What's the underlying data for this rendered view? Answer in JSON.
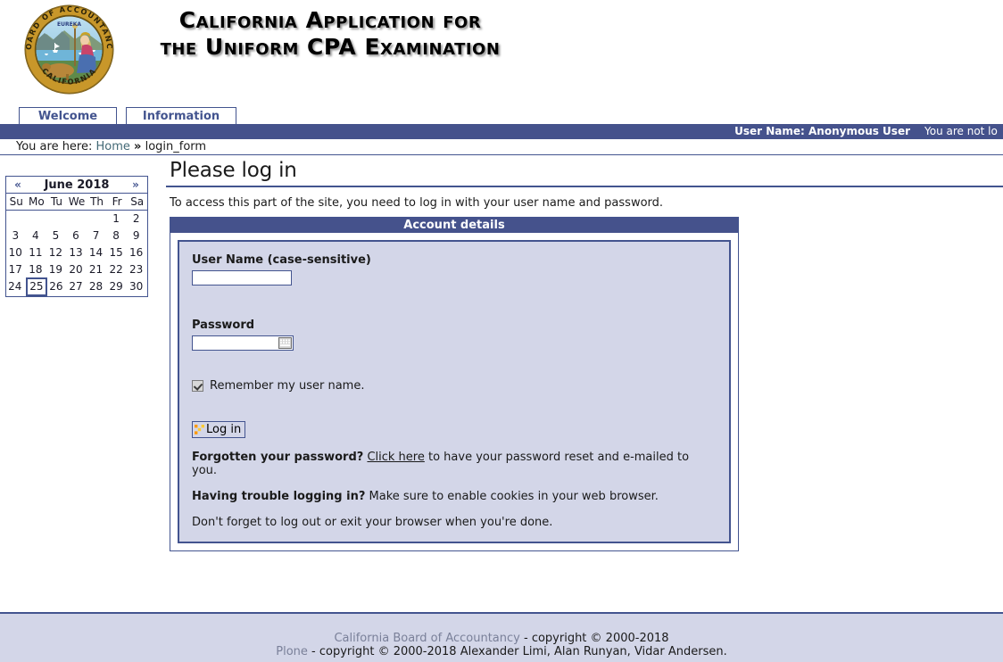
{
  "header": {
    "seal_outer_top_text": "BOARD OF ACCOUNTANCY",
    "seal_outer_bottom_text": "CALIFORNIA",
    "seal_motto": "EUREKA",
    "title_line1": "California Application for",
    "title_line2": "the Uniform CPA Examination"
  },
  "tabs": [
    {
      "label": "Welcome",
      "selected": false
    },
    {
      "label": "Information",
      "selected": false
    }
  ],
  "user_bar": {
    "user_name_label": "User Name: Anonymous User",
    "login_status": "You are not lo"
  },
  "breadcrumb": {
    "prefix": "You are here:",
    "home_label": "Home",
    "separator": "»",
    "current": "login_form"
  },
  "calendar": {
    "prev_label": "«",
    "next_label": "»",
    "month_label": "June 2018",
    "weekdays": [
      "Su",
      "Mo",
      "Tu",
      "We",
      "Th",
      "Fr",
      "Sa"
    ],
    "weeks": [
      [
        "",
        "",
        "",
        "",
        "",
        "1",
        "2"
      ],
      [
        "3",
        "4",
        "5",
        "6",
        "7",
        "8",
        "9"
      ],
      [
        "10",
        "11",
        "12",
        "13",
        "14",
        "15",
        "16"
      ],
      [
        "17",
        "18",
        "19",
        "20",
        "21",
        "22",
        "23"
      ],
      [
        "24",
        "25",
        "26",
        "27",
        "28",
        "29",
        "30"
      ]
    ],
    "today": "25"
  },
  "main": {
    "page_title": "Please log in",
    "intro": "To access this part of the site, you need to log in with your user name and password.",
    "panel_title": "Account details",
    "username_label": "User Name (case-sensitive)",
    "username_value": "",
    "username_placeholder": "",
    "password_label": "Password",
    "password_value": "",
    "password_placeholder": "",
    "remember_label": "Remember my user name.",
    "remember_checked": true,
    "login_button_label": "Log in",
    "forgot_bold": "Forgotten your password?",
    "forgot_link": "Click here",
    "forgot_rest": " to have your password reset and e-mailed to you.",
    "trouble_bold": "Having trouble logging in?",
    "trouble_rest": " Make sure to enable cookies in your web browser.",
    "logout_reminder": "Don't forget to log out or exit your browser when you're done."
  },
  "footer": {
    "line1_link": "California Board of Accountancy",
    "line1_rest": " - copyright © 2000-2018",
    "line2_link": "Plone",
    "line2_rest": " - copyright © 2000-2018 Alexander Limi, Alan Runyan, Vidar Andersen."
  },
  "colors": {
    "navy": "#43548f",
    "navy_bar": "#45528c",
    "lavender": "#d3d6e8",
    "link_blue": "#436976",
    "footer_link": "#7a8099",
    "seal_gold": "#c8972a",
    "accent_orange": "#ff9900"
  }
}
